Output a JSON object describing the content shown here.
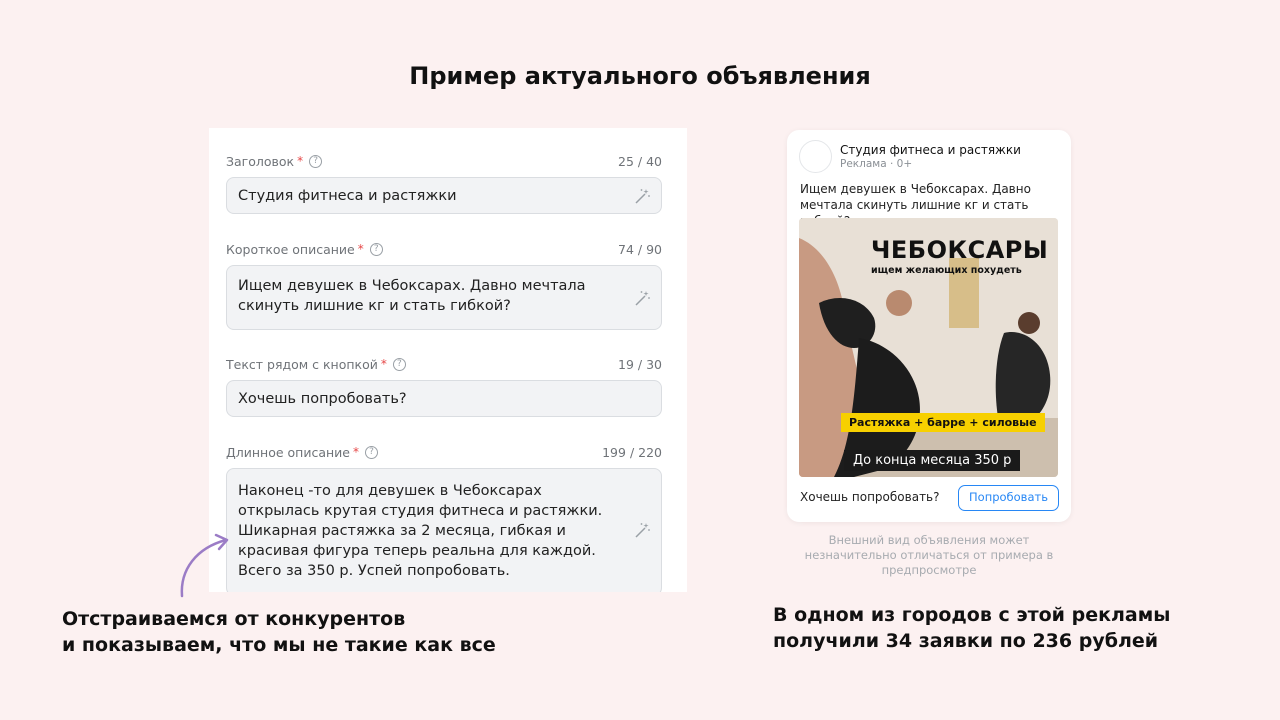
{
  "slide": {
    "title": "Пример актуального объявления",
    "caption_left": [
      "Отстраиваемся от конкурентов",
      "и показываем, что мы не такие как все"
    ],
    "caption_right": [
      "В одном из городов с этой рекламы",
      "получили 34 заявки по 236 рублей"
    ]
  },
  "form": {
    "fields": [
      {
        "label": "Заголовок",
        "counter": "25 / 40",
        "value": "Студия фитнеса и растяжки",
        "icon": "magic-wand-icon"
      },
      {
        "label": "Короткое описание",
        "counter": "74 / 90",
        "value": "Ищем девушек в Чебоксарах. Давно мечтала скинуть лишние кг и стать гибкой?",
        "icon": "magic-wand-icon"
      },
      {
        "label": "Текст рядом с кнопкой",
        "counter": "19 / 30",
        "value": "Хочешь попробовать?"
      },
      {
        "label": "Длинное описание",
        "counter": "199 / 220",
        "value": "Наконец -то для девушек в Чебоксарах открылась крутая студия фитнеса и растяжки.  Шикарная растяжка за 2 месяца, гибкая и красивая фигура теперь реальна для каждой. Всего за 350 р. Успей попробовать.",
        "icon": "magic-wand-icon"
      }
    ],
    "required_mark": "*",
    "help_glyph": "?"
  },
  "preview": {
    "name": "Студия фитнеса и растяжки",
    "subline": "Реклама · 0+",
    "text": "Ищем девушек в Чебоксарах. Давно мечтала скинуть лишние кг и стать гибкой?",
    "image": {
      "title": "ЧЕБОКСАРЫ",
      "subtitle": "ищем желающих похудеть",
      "banner": "Растяжка + барре + силовые",
      "price": "До конца месяца 350 р"
    },
    "cta_text": "Хочешь попробовать?",
    "cta_button": "Попробовать",
    "disclaimer": "Внешний вид объявления может незначительно отличаться от примера в предпросмотре"
  },
  "colors": {
    "background": "#fcf1f1",
    "accent_blue": "#2787f5",
    "required_red": "#e64646",
    "banner_yellow": "#f7d000",
    "arrow_purple": "#9b7cc6"
  }
}
